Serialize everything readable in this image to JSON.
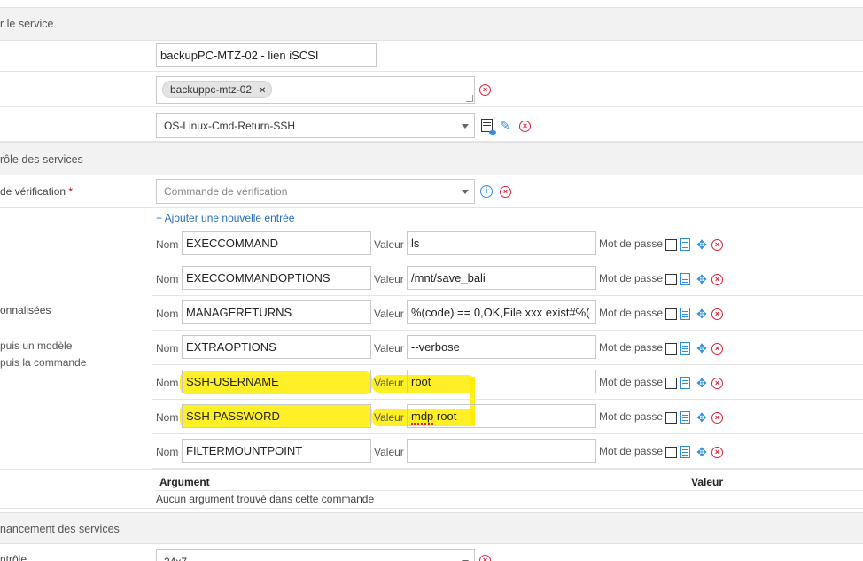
{
  "sections": {
    "service": "r le service",
    "controle": "rôle des services",
    "ordonnancement": "nancement des services"
  },
  "fields": {
    "description_value": "backupPC-MTZ-02 - lien iSCSI",
    "host_tag": "backuppc-mtz-02",
    "template_value": "OS-Linux-Cmd-Return-SSH",
    "check_command_label": "de vérification",
    "check_command_required": "*",
    "check_command_placeholder": "Commande de vérification",
    "check_period_label": "ntrôle",
    "check_period_value": "24x7"
  },
  "macros": {
    "add_entry_label": "+ Ajouter une nouvelle entrée",
    "section_label": "onnalisées",
    "note_line1": "puis un modèle",
    "note_line2": "puis la commande",
    "nom_label": "Nom",
    "valeur_label": "Valeur",
    "mdp_label": "Mot de passe",
    "rows": [
      {
        "name": "EXECCOMMAND",
        "value": "ls"
      },
      {
        "name": "EXECCOMMANDOPTIONS",
        "value": "/mnt/save_bali"
      },
      {
        "name": "MANAGERETURNS",
        "value": "%(code) == 0,OK,File xxx exist#%("
      },
      {
        "name": "EXTRAOPTIONS",
        "value": "--verbose"
      },
      {
        "name": "SSH-USERNAME",
        "value": "root"
      },
      {
        "name": "SSH-PASSWORD",
        "value_word1": "mdp",
        "value_word2": "root"
      },
      {
        "name": "FILTERMOUNTPOINT",
        "value": ""
      }
    ]
  },
  "arguments": {
    "col_argument": "Argument",
    "col_valeur": "Valeur",
    "empty": "Aucun argument trouvé dans cette commande"
  },
  "colors": {
    "highlight": "#ffec00",
    "link": "#2a6ebb",
    "danger": "#e0203d",
    "info": "#2f8fde"
  }
}
